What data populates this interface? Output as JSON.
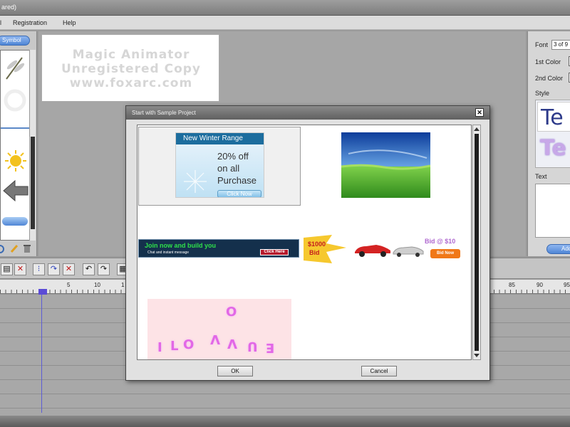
{
  "window": {
    "title": "ared)"
  },
  "menu": {
    "items": [
      "l",
      "Registration",
      "Help"
    ]
  },
  "left_panel": {
    "tab_label": "Symbol"
  },
  "canvas": {
    "watermark": [
      "Magic Animator",
      "Unregistered Copy",
      "www.foxarc.com"
    ]
  },
  "right_panel": {
    "font_label": "Font",
    "font_value": "3 of 9",
    "color1_label": "1st Color",
    "color2_label": "2nd Color",
    "style_label": "Style",
    "style_sample": "Te",
    "text_label": "Text",
    "add_label": "Add"
  },
  "ruler": {
    "ticks": [
      "5",
      "10",
      "1",
      "85",
      "90",
      "95"
    ]
  },
  "dialog": {
    "title": "Start with Sample Project",
    "close_glyph": "✕",
    "ok_label": "OK",
    "cancel_label": "Cancel",
    "samples": {
      "winter": {
        "header": "New Winter Range",
        "body": "20% off\non all\nPurchase",
        "button": "Click Now"
      },
      "banner": {
        "heading": "Join now and build you",
        "sub": "Chat and instant message",
        "button": "Click Here"
      },
      "auction": {
        "price": "$1000",
        "bid": "Bid",
        "right_text": "Bid @ $10",
        "button": "Bid Now"
      },
      "love": {
        "letters": "I LO... O"
      }
    }
  },
  "colors": {
    "accent_blue": "#4f86d6",
    "dialog_title": "#606060",
    "playhead": "#5c5cd6"
  }
}
